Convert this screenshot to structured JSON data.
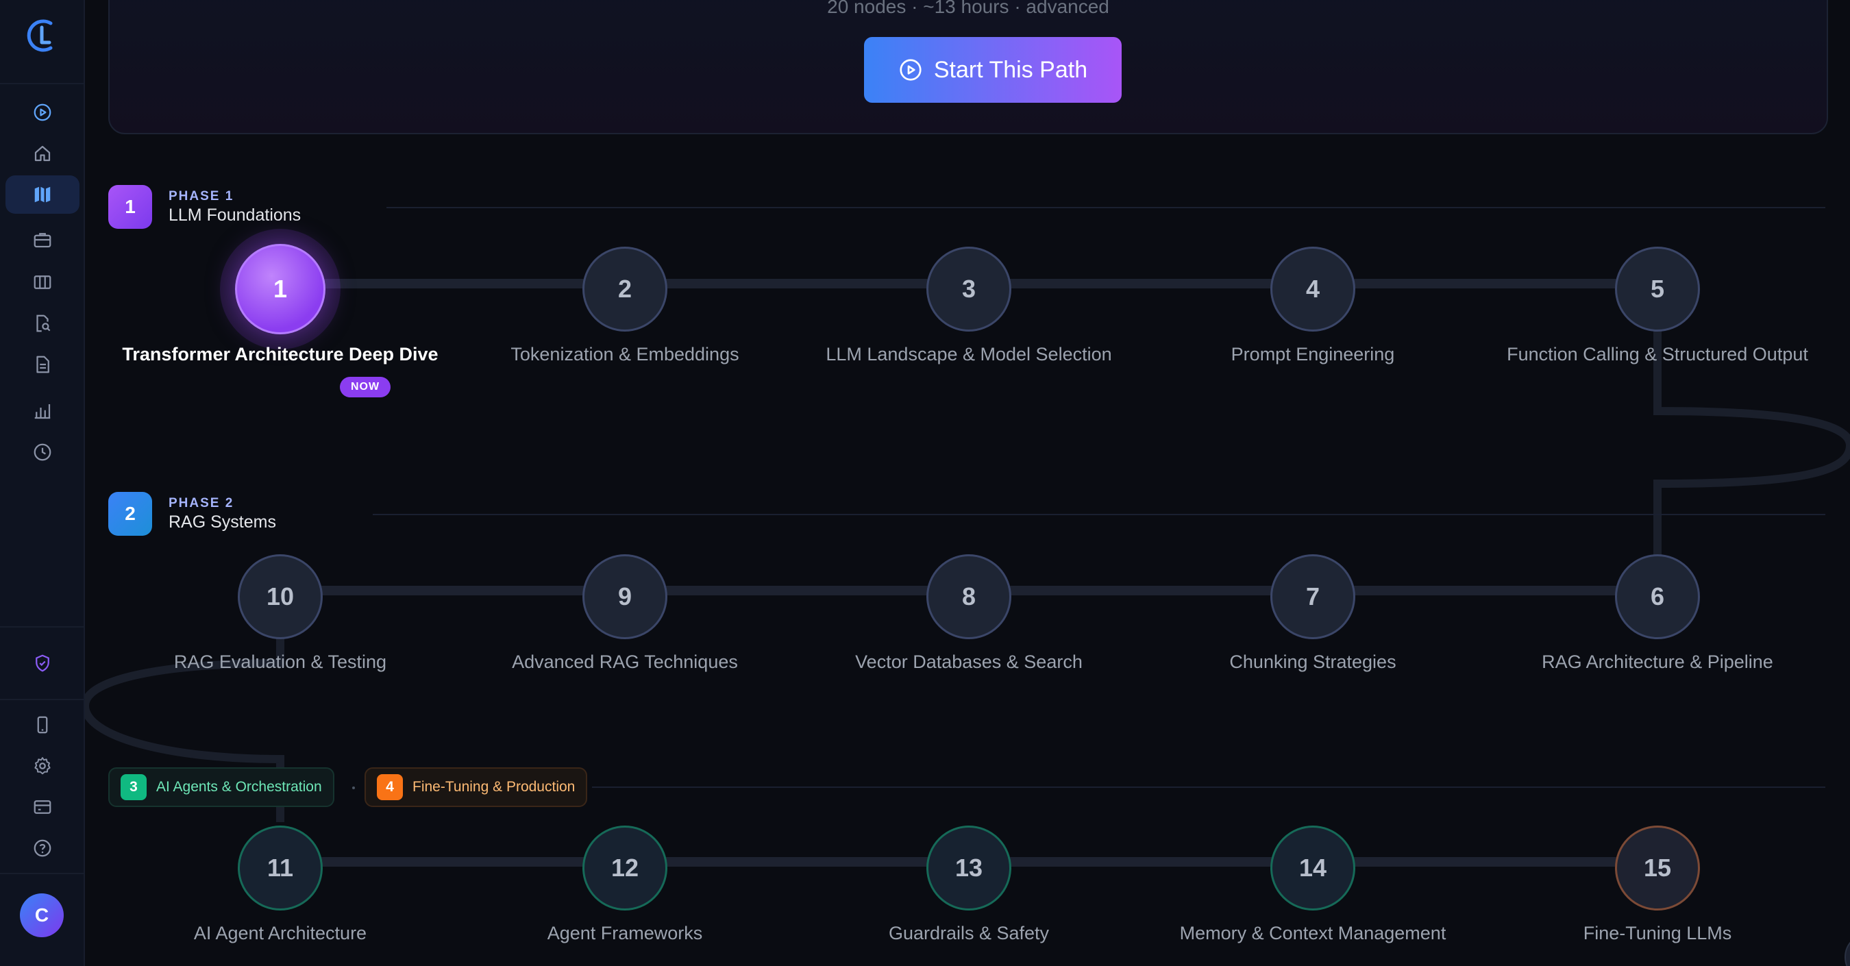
{
  "hero": {
    "meta": "20 nodes · ~13 hours · advanced",
    "start_label": "Start This Path"
  },
  "sidebar": {
    "items": [
      {
        "name": "play-circle-icon"
      },
      {
        "name": "home-icon"
      },
      {
        "name": "roadmap-icon",
        "active": true
      },
      {
        "name": "briefcase-icon"
      },
      {
        "name": "columns-icon"
      },
      {
        "name": "search-document-icon"
      },
      {
        "name": "document-icon"
      },
      {
        "name": "bar-chart-icon"
      },
      {
        "name": "clock-icon"
      }
    ],
    "bottom_items": [
      {
        "name": "shield-check-icon"
      },
      {
        "name": "mobile-icon"
      },
      {
        "name": "gear-icon"
      },
      {
        "name": "credit-card-icon"
      },
      {
        "name": "help-circle-icon"
      }
    ],
    "avatar_initial": "C"
  },
  "phases": [
    {
      "number": "1",
      "label": "PHASE 1",
      "name": "LLM Foundations",
      "color": "#a855f7"
    },
    {
      "number": "2",
      "label": "PHASE 2",
      "name": "RAG Systems",
      "color": "#3b82f6"
    }
  ],
  "chips": [
    {
      "number": "3",
      "name": "AI Agents & Orchestration",
      "color": "#10b981"
    },
    {
      "number": "4",
      "name": "Fine-Tuning & Production",
      "color": "#f97316"
    }
  ],
  "nodes": [
    {
      "number": "1",
      "label": "Transformer Architecture Deep Dive",
      "status": "current",
      "badge": "NOW"
    },
    {
      "number": "2",
      "label": "Tokenization & Embeddings"
    },
    {
      "number": "3",
      "label": "LLM Landscape & Model Selection"
    },
    {
      "number": "4",
      "label": "Prompt Engineering"
    },
    {
      "number": "5",
      "label": "Function Calling & Structured Output"
    },
    {
      "number": "6",
      "label": "RAG Architecture & Pipeline"
    },
    {
      "number": "7",
      "label": "Chunking Strategies"
    },
    {
      "number": "8",
      "label": "Vector Databases & Search"
    },
    {
      "number": "9",
      "label": "Advanced RAG Techniques"
    },
    {
      "number": "10",
      "label": "RAG Evaluation & Testing"
    },
    {
      "number": "11",
      "label": "AI Agent Architecture"
    },
    {
      "number": "12",
      "label": "Agent Frameworks"
    },
    {
      "number": "13",
      "label": "Guardrails & Safety"
    },
    {
      "number": "14",
      "label": "Memory & Context Management"
    },
    {
      "number": "15",
      "label": "Fine-Tuning LLMs"
    }
  ]
}
